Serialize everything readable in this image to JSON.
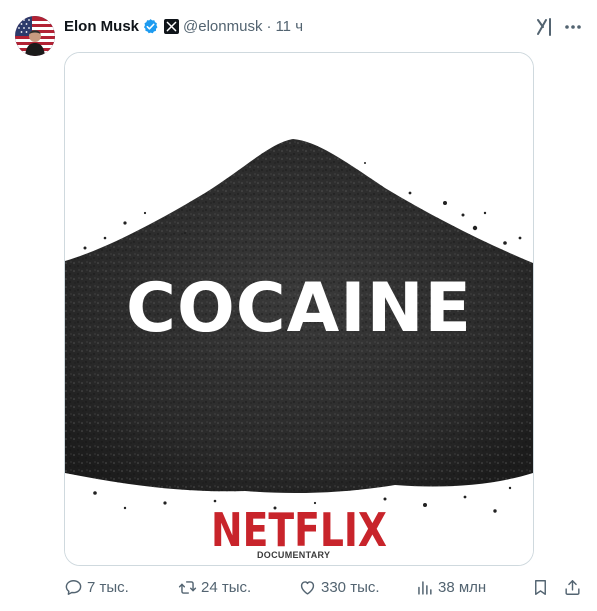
{
  "author": {
    "name": "Elon Musk",
    "handle": "@elonmusk",
    "separator": "·",
    "time": "11 ч"
  },
  "header_icons": [
    "verified-badge-icon",
    "x-affiliate-icon",
    "grok-icon",
    "more-icon"
  ],
  "media": {
    "headline": "COCAINE",
    "brand": "NETFLIX",
    "brand_subtitle": "DOCUMENTARY"
  },
  "actions": {
    "replies": "7 тыс.",
    "reposts": "24 тыс.",
    "likes": "330 тыс.",
    "views": "38 млн"
  },
  "colors": {
    "text": "#0f1419",
    "secondary_text": "#536471",
    "verified": "#1d9bf0",
    "border": "#cfd9de",
    "brand_red": "#c8242b"
  }
}
